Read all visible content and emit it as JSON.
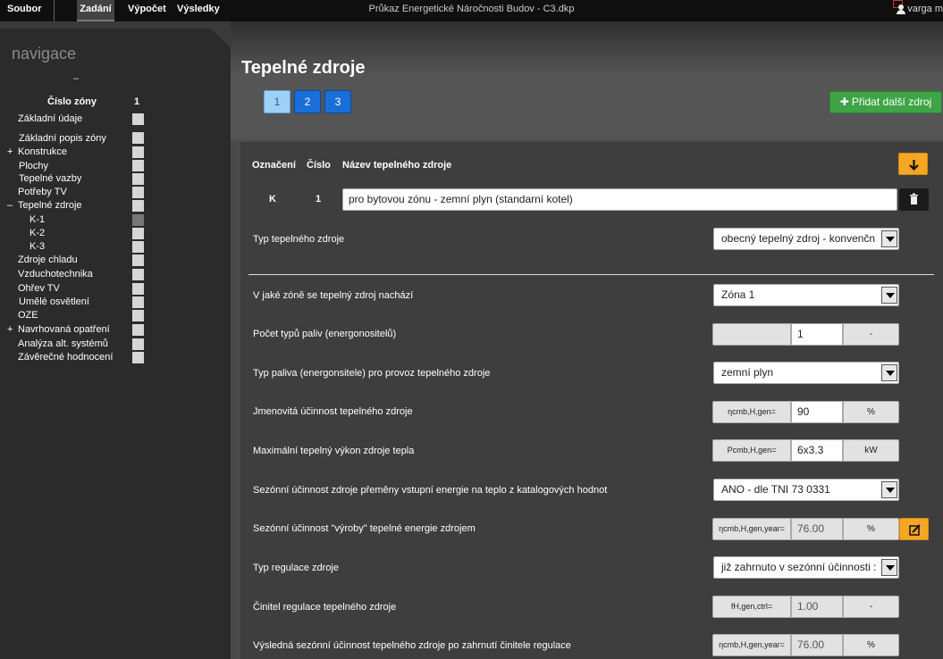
{
  "topbar": {
    "menu": [
      "Soubor",
      "Zadání",
      "Výpočet",
      "Výsledky"
    ],
    "title": "Průkaz Energetické Náročnosti Budov - C3.dkp",
    "user": "varga m"
  },
  "sidebar": {
    "title": "navigace",
    "dash": "–",
    "zone_label": "Číslo zóny",
    "zone_number": "1",
    "items": [
      {
        "label": "Základní údaje",
        "prefix": ""
      },
      {
        "label": "Základní popis zóny",
        "prefix": ""
      },
      {
        "label": "Konstrukce",
        "prefix": "+"
      },
      {
        "label": "Plochy",
        "prefix": ""
      },
      {
        "label": "Tepelné vazby",
        "prefix": ""
      },
      {
        "label": "Potřeby TV",
        "prefix": ""
      },
      {
        "label": "Tepelné zdroje",
        "prefix": "–"
      },
      {
        "label": "K-1",
        "prefix": ""
      },
      {
        "label": "K-2",
        "prefix": ""
      },
      {
        "label": "K-3",
        "prefix": ""
      },
      {
        "label": "Zdroje chladu",
        "prefix": ""
      },
      {
        "label": "Vzduchotechnika",
        "prefix": ""
      },
      {
        "label": "Ohřev TV",
        "prefix": ""
      },
      {
        "label": "Umělé osvětlení",
        "prefix": ""
      },
      {
        "label": "OZE",
        "prefix": ""
      },
      {
        "label": "Navrhovaná opatření",
        "prefix": "+"
      },
      {
        "label": "Analýza alt. systémů",
        "prefix": ""
      },
      {
        "label": "Závěrečné hodnocení",
        "prefix": ""
      }
    ]
  },
  "main": {
    "title": "Tepelné zdroje",
    "pages": [
      "1",
      "2",
      "3"
    ],
    "add_button": "Přidat další zdroj",
    "headers": {
      "designation": "Označení",
      "number": "Číslo",
      "name": "Název tepelného zdroje"
    },
    "source": {
      "designation": "K",
      "number": "1",
      "name": "pro  bytovou zónu - zemní plyn (standarní kotel)"
    },
    "fields": {
      "type_label": "Typ tepelného zdroje",
      "type_value": "obecný tepelný zdroj - konvenčn",
      "zone_label": "V jaké zóně se tepelný zdroj nachází",
      "zone_value": "Zóna 1",
      "fuel_count_label": "Počet typů paliv (energonositelů)",
      "fuel_count_value": "1",
      "fuel_count_unit": "-",
      "fuel_label": "Typ paliva (energonsitele) pro provoz tepelného zdroje",
      "fuel_value": "zemní plyn",
      "eff_label": "Jmenovitá účinnost tepelného zdroje",
      "eff_sym": "ηcmb,H,gen=",
      "eff_value": "90",
      "eff_unit": "%",
      "power_label": "Maximální tepelný výkon zdroje tepla",
      "power_sym": "Pcmb,H,gen=",
      "power_value": "6x3.3",
      "power_unit": "kW",
      "catalog_label": "Sezónní účinnost zdroje přeměny vstupní energie na teplo z katalogových hodnot",
      "catalog_value": "ANO - dle TNI 73 0331",
      "seasonal_label": "Sezónní účinnost \"výroby\" tepelné energie zdrojem",
      "seasonal_sym": "ηcmb,H,gen,year=",
      "seasonal_value": "76.00",
      "seasonal_unit": "%",
      "reg_type_label": "Typ regulace zdroje",
      "reg_type_value": "již zahrnuto v sezónní účinnosti :",
      "reg_factor_label": "Činitel regulace tepelného zdroje",
      "reg_factor_sym": "fH,gen,ctrl=",
      "reg_factor_value": "1.00",
      "reg_factor_unit": "-",
      "result_label": "Výsledná sezónní účinnost tepelného zdroje po zahrnutí činitele regulace",
      "result_sym": "ηcmb,H,gen,year=",
      "result_value": "76.00",
      "result_unit": "%"
    }
  }
}
